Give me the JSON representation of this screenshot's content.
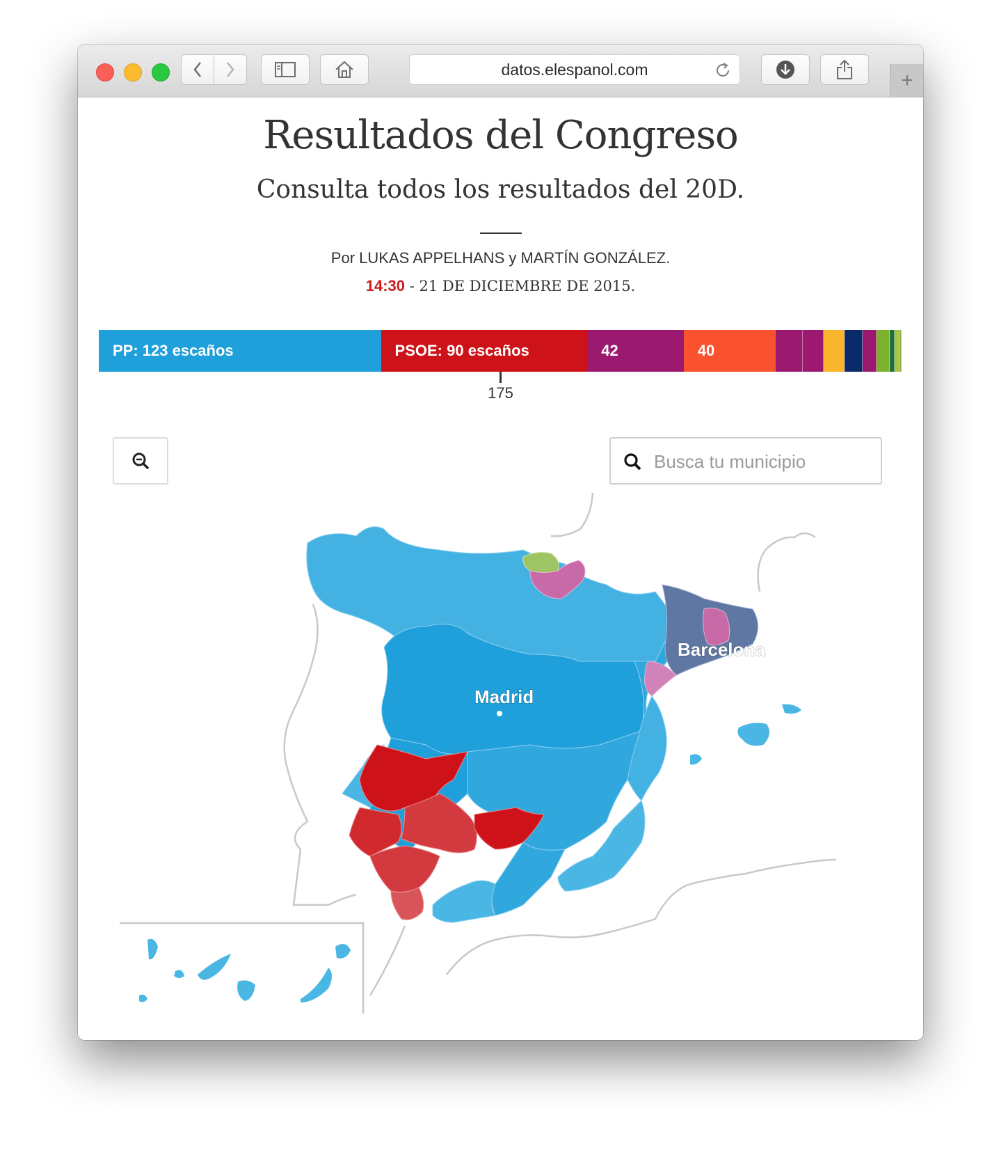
{
  "browser": {
    "url": "datos.elespanol.com",
    "new_tab_symbol": "+"
  },
  "article": {
    "title": "Resultados del Congreso",
    "subtitle": "Consulta todos los resultados del 20D.",
    "byline": "Por LUKAS APPELHANS y MARTÍN GONZÁLEZ.",
    "time": "14:30",
    "date": "- 21 DE DICIEMBRE DE 2015."
  },
  "seats": {
    "total": 350,
    "majority_label": "175",
    "parties": [
      {
        "label": "PP: 123 escaños",
        "seats": 123,
        "color": "#1fa0db"
      },
      {
        "label": "PSOE: 90 escaños",
        "seats": 90,
        "color": "#cd1219"
      },
      {
        "label": "42",
        "seats": 42,
        "color": "#9b1a6f"
      },
      {
        "label": "40",
        "seats": 40,
        "color": "#fa512e"
      },
      {
        "label": "",
        "seats": 12,
        "color": "#9b1a6f"
      },
      {
        "label": "",
        "seats": 9,
        "color": "#9b1a6f"
      },
      {
        "label": "",
        "seats": 9,
        "color": "#f9b52c"
      },
      {
        "label": "",
        "seats": 8,
        "color": "#0b2a6a"
      },
      {
        "label": "",
        "seats": 6,
        "color": "#9b1a6f"
      },
      {
        "label": "",
        "seats": 6,
        "color": "#7bb12c"
      },
      {
        "label": "",
        "seats": 2,
        "color": "#1f6f38"
      },
      {
        "label": "",
        "seats": 2,
        "color": "#a9c442"
      },
      {
        "label": "",
        "seats": 1,
        "color": "#8fae44"
      }
    ]
  },
  "controls": {
    "search_placeholder": "Busca tu municipio",
    "zoom_icon": "zoom-out-icon",
    "search_icon": "search-icon"
  },
  "map": {
    "cities": [
      "Madrid",
      "Barcelona"
    ],
    "colors": {
      "pp": "#1fa0db",
      "pp_light": "#4ab6e4",
      "psoe": "#cd1219",
      "psoe_light": "#d6474b",
      "podemos": "#c86aa8",
      "catalan": "#5f77a3",
      "basque": "#9fc463",
      "neighbour_outline": "#c8c8c8"
    }
  }
}
